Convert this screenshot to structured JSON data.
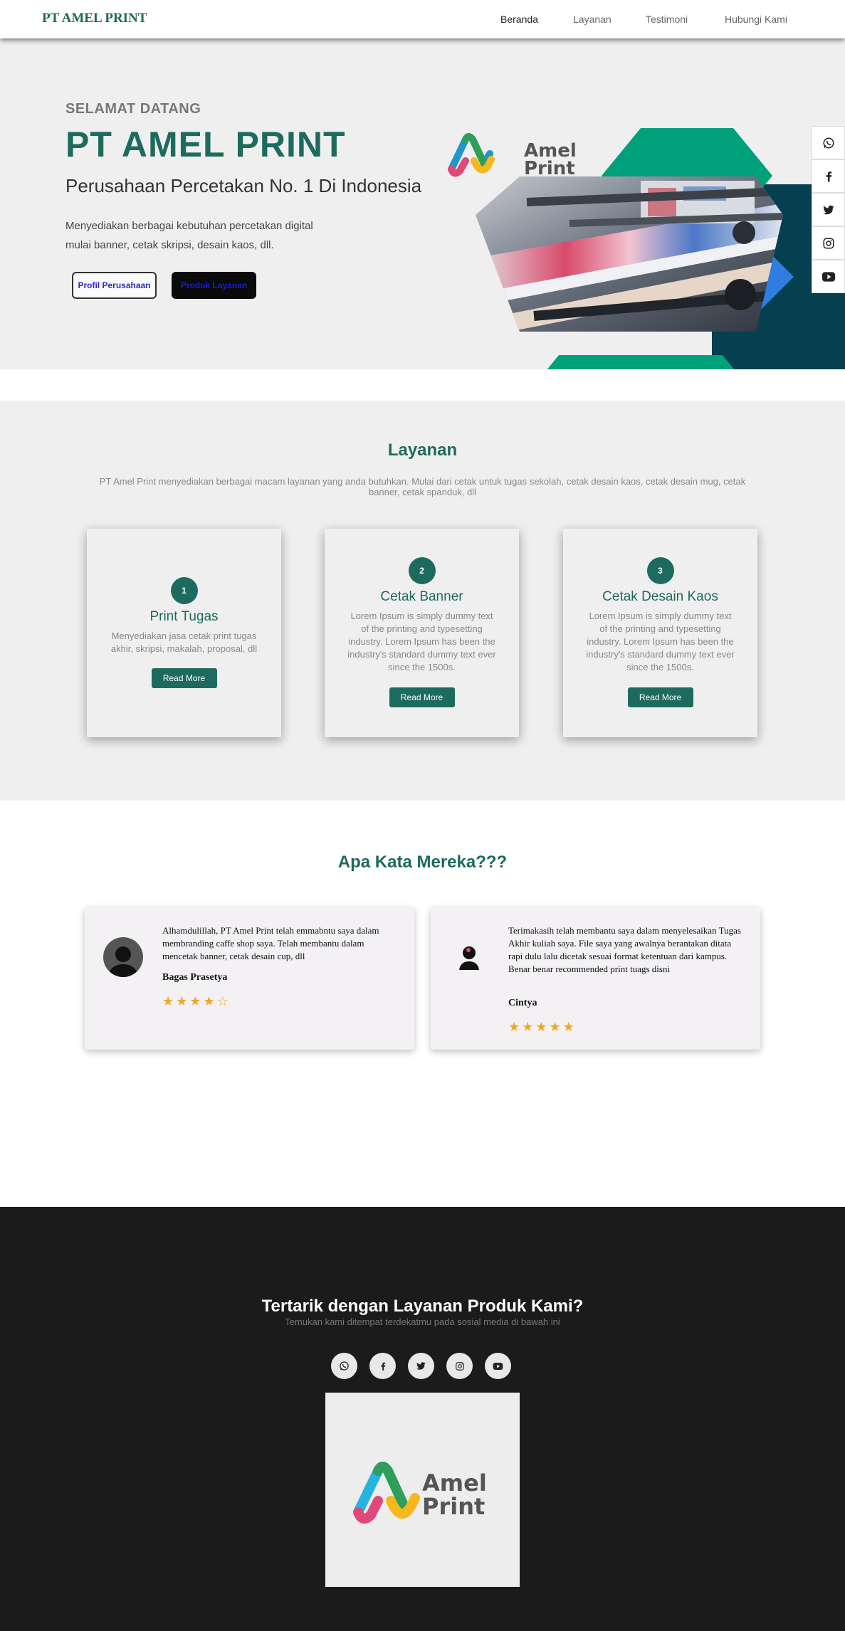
{
  "nav": {
    "brand": "PT AMEL PRINT",
    "links": [
      "Beranda",
      "Layanan",
      "Testimoni",
      "Hubungi Kami"
    ]
  },
  "hero": {
    "welcome": "SELAMAT DATANG",
    "title": "PT AMEL PRINT",
    "subtitle": "Perusahaan Percetakan No. 1 Di Indonesia",
    "desc_line1": "Menyediakan berbagai kebutuhan percetakan digital",
    "desc_line2": "mulai banner, cetak skripsi, desain kaos, dll.",
    "btn_profile": "Profil Perusahaan",
    "btn_products": "Produk Layanan",
    "logo_word1": "Amel",
    "logo_word2": "Print"
  },
  "side_social": [
    "whatsapp-icon",
    "facebook-icon",
    "twitter-icon",
    "instagram-icon",
    "youtube-icon"
  ],
  "services": {
    "title": "Layanan",
    "desc": "PT Amel Print menyediakan berbagai macam layanan yang anda butuhkan. Mulai dari cetak untuk tugas sekolah, cetak desain kaos, cetak desain mug, cetak banner, cetak spanduk, dll",
    "cards": [
      {
        "num": "1",
        "title": "Print Tugas",
        "text": "Menyediakan jasa cetak print tugas akhir, skripsi, makalah, proposal, dll",
        "btn": "Read More"
      },
      {
        "num": "2",
        "title": "Cetak Banner",
        "text": "Lorem Ipsum is simply dummy text of the printing and typesetting industry. Lorem Ipsum has been the industry's standard dummy text ever since the 1500s.",
        "btn": "Read More"
      },
      {
        "num": "3",
        "title": "Cetak Desain Kaos",
        "text": "Lorem Ipsum is simply dummy text of the printing and typesetting industry. Lorem Ipsum has been the industry's standard dummy text ever since the 1500s.",
        "btn": "Read More"
      }
    ]
  },
  "testimoni": {
    "title": "Apa Kata Mereka???",
    "items": [
      {
        "quote": "Alhamdulillah, PT Amel Print telah emmabntu saya dalam membranding caffe shop saya. Telah membantu dalam mencetak banner, cetak desain cup, dll",
        "name": "Bagas Prasetya",
        "rating": 4
      },
      {
        "quote": "Terimakasih telah membantu saya dalam menyelesaikan Tugas Akhir kuliah saya. File saya yang awalnya berantakan ditata rapi dulu lalu dicetak sesuai format ketentuan dari kampus. Benar benar recommended print tuags disni",
        "name": "Cintya",
        "rating": 5
      }
    ]
  },
  "footer": {
    "title": "Tertarik dengan Layanan Produk Kami?",
    "subtitle": "Temukan kami ditempat terdekatmu pada sosial media di bawah ini",
    "social": [
      "whatsapp-icon",
      "facebook-icon",
      "twitter-icon",
      "instagram-icon",
      "youtube-icon"
    ],
    "logo_word1": "Amel",
    "logo_word2": "Print"
  },
  "colors": {
    "brand": "#1d6b5e",
    "accent_green": "#00a07a",
    "dark_teal": "#063f4f",
    "star": "#f5a623",
    "footer_bg": "#1b1b1c"
  }
}
